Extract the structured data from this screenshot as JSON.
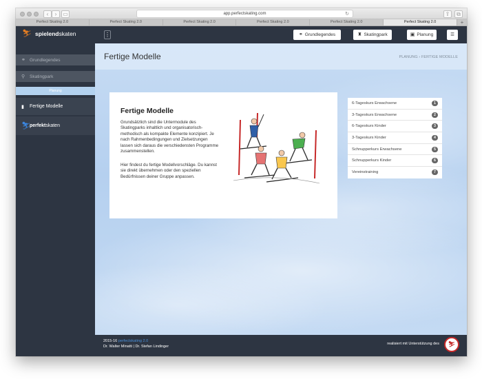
{
  "browser": {
    "url": "app.perfectskating.com",
    "tabs": [
      "Perfect Skating 2.0",
      "Perfect Skating 2.0",
      "Perfect Skating 2.0",
      "Perfect Skating 2.0",
      "Perfect Skating 2.0",
      "Perfect Skating 2.0"
    ],
    "active_tab": 5
  },
  "sidebar": {
    "brand_bold": "spielend",
    "brand_rest": "skaten",
    "items": [
      {
        "label": "Grundlegendes",
        "icon": "bicycle-icon"
      },
      {
        "label": "Skatingpark",
        "icon": "bench-icon"
      },
      {
        "label": "Planung",
        "icon": ""
      },
      {
        "label": "Fertige Modelle",
        "icon": "book-icon"
      }
    ],
    "perfekt_bold": "perfekt",
    "perfekt_rest": "skaten"
  },
  "topnav": {
    "grundlegendes": "Grundlegendes",
    "skatingpark": "Skatingpark",
    "planung": "Planung"
  },
  "page": {
    "title": "Fertige Modelle",
    "breadcrumb": [
      "PLANUNG",
      "FERTIGE MODELLE"
    ]
  },
  "card": {
    "title": "Fertige Modelle",
    "p1": "Grundsätzlich sind die Untermodule des Skatingparks inhaltlich und organisatorisch-methodisch als kompakte Elemente konzipiert. Je nach Rahmenbedingungen und Zielsetzungen lassen sich daraus die verschiedensten Programme zusammenstellen.",
    "p2": "Hier findest du fertige Modellvorschläge. Du kannst sie direkt übernehmen oder den speziellen Bedürfnissen deiner Gruppe anpassen."
  },
  "models": [
    {
      "label": "6-Tageskurs Erwachsene",
      "num": "1"
    },
    {
      "label": "3-Tageskurs Erwachsene",
      "num": "2"
    },
    {
      "label": "6-Tageskurs Kinder",
      "num": "3"
    },
    {
      "label": "3-Tageskurs Kinder",
      "num": "4"
    },
    {
      "label": "Schnupperkurs Erwachsene",
      "num": "5"
    },
    {
      "label": "Schnupperkurs Kinder",
      "num": "6"
    },
    {
      "label": "Vereinstraining",
      "num": "7"
    }
  ],
  "footer": {
    "year": "2015-16",
    "brandname": "perfectskating 2.0",
    "authors": "Dr. Walter Minatti | Dr. Stefan Lindinger",
    "support": "realisiert mit Unterstützung des"
  },
  "colors": {
    "dark": "#2d3542",
    "accent_orange": "#e67e22",
    "accent_blue": "#4a90d9",
    "badge": "#666666"
  }
}
